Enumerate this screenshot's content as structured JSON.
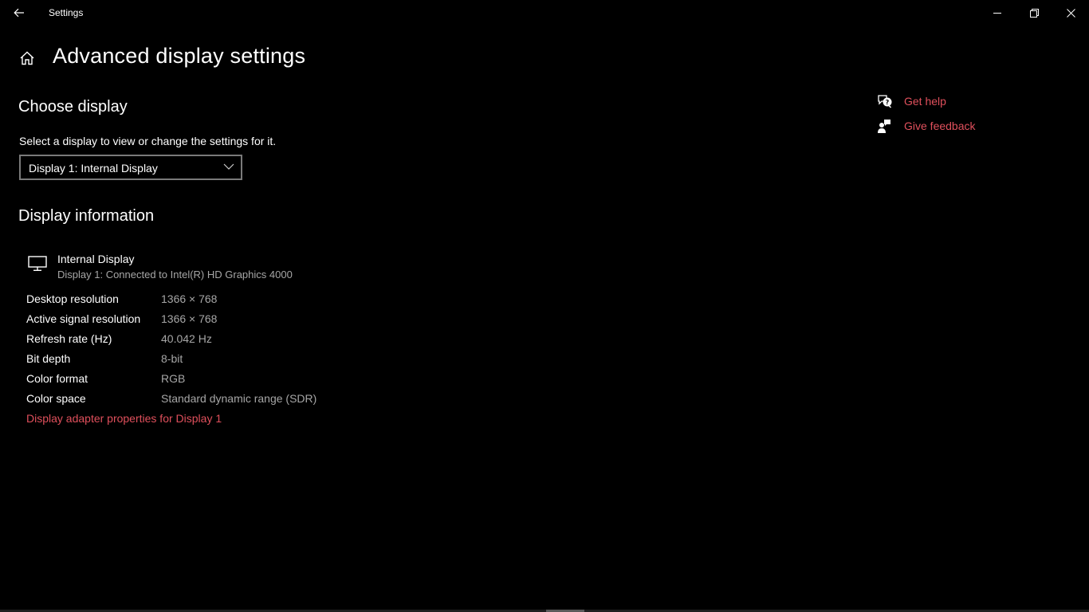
{
  "window": {
    "title": "Settings",
    "controls": {
      "back": "back-arrow-icon",
      "minimize": "minimize-icon",
      "maximize": "restore-icon",
      "close": "close-icon"
    }
  },
  "header": {
    "home_icon": "home-icon",
    "title": "Advanced display settings"
  },
  "choose_display": {
    "heading": "Choose display",
    "description": "Select a display to view or change the settings for it.",
    "dropdown": {
      "selected": "Display 1: Internal Display",
      "icon": "chevron-down-icon"
    }
  },
  "display_information": {
    "heading": "Display information",
    "display_icon": "monitor-icon",
    "display_name": "Internal Display",
    "display_subtitle": "Display 1: Connected to Intel(R) HD Graphics 4000",
    "rows": [
      {
        "label": "Desktop resolution",
        "value": "1366 × 768"
      },
      {
        "label": "Active signal resolution",
        "value": "1366 × 768"
      },
      {
        "label": "Refresh rate (Hz)",
        "value": "40.042 Hz"
      },
      {
        "label": "Bit depth",
        "value": "8-bit"
      },
      {
        "label": "Color format",
        "value": "RGB"
      },
      {
        "label": "Color space",
        "value": "Standard dynamic range (SDR)"
      }
    ],
    "adapter_link": "Display adapter properties for Display 1"
  },
  "side_links": [
    {
      "label": "Get help",
      "icon": "help-chat-icon"
    },
    {
      "label": "Give feedback",
      "icon": "feedback-icon"
    }
  ],
  "colors": {
    "background": "#000000",
    "accent": "#e0505c",
    "secondary_text": "#a6a6a6",
    "dropdown_border": "#7a7a7a"
  }
}
